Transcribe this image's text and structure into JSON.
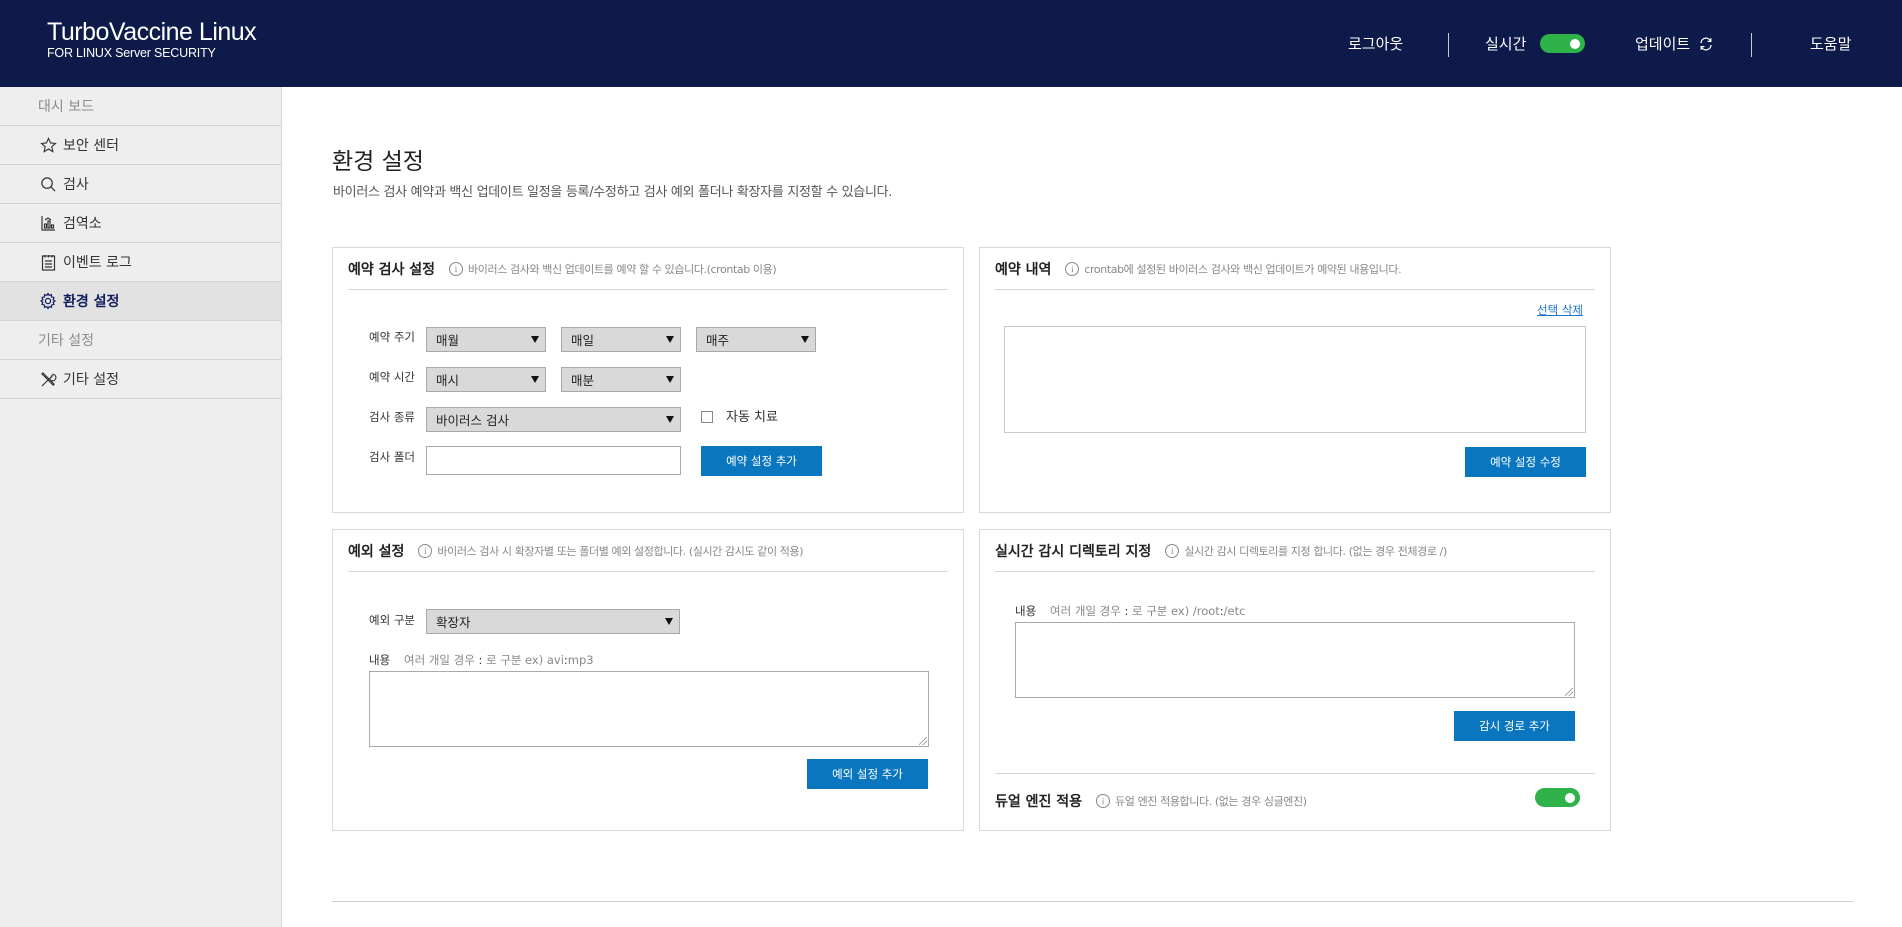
{
  "app": {
    "title": "TurboVaccine Linux",
    "subtitle": "FOR LINUX Server SECURITY"
  },
  "header": {
    "logout": "로그아웃",
    "realtime": "실시간",
    "realtime_on": true,
    "update": "업데이트",
    "help": "도움말"
  },
  "sidebar": {
    "section1": "대시 보드",
    "items": [
      {
        "label": "보안 센터",
        "icon": "star-icon"
      },
      {
        "label": "검사",
        "icon": "search-icon"
      },
      {
        "label": "검역소",
        "icon": "quarantine-icon"
      },
      {
        "label": "이벤트 로그",
        "icon": "log-icon"
      },
      {
        "label": "환경 설정",
        "icon": "gear-icon",
        "active": true
      }
    ],
    "section2": "기타 설정",
    "items2": [
      {
        "label": "기타 설정",
        "icon": "tools-icon"
      }
    ]
  },
  "page": {
    "title": "환경 설정",
    "description": "바이러스 검사 예약과 백신 업데이트 일정을 등록/수정하고 검사 예외 폴더나 확장자를 지정할 수 있습니다."
  },
  "schedule": {
    "title": "예약 검사 설정",
    "desc": "바이러스 검사와 백신 업데이트를 예약 할 수 있습니다.(crontab 이용)",
    "period_label": "예약 주기",
    "period_month": "매월",
    "period_day": "매일",
    "period_week": "매주",
    "time_label": "예약 시간",
    "time_hour": "매시",
    "time_minute": "매분",
    "type_label": "검사 종류",
    "type_value": "바이러스 검사",
    "auto_treat": "자동 치료",
    "folder_label": "검사 폴더",
    "folder_value": "",
    "add_button": "예약 설정 추가"
  },
  "history": {
    "title": "예약 내역",
    "desc": "crontab에 설정된 바이러스 검사와 백신 업데이트가 예약된 내용입니다.",
    "delete_link": "선택 삭제",
    "edit_button": "예약 설정 수정"
  },
  "exception": {
    "title": "예외 설정",
    "desc": "바이러스 검사 시 확장자별 또는 폴더별 예외 설정합니다. (실시간 감시도 같이 적용)",
    "type_label": "예외 구분",
    "type_value": "확장자",
    "content_label": "내용",
    "hint_a": "여러 개일 경우",
    "hint_colon": ":",
    "hint_b": "로 구분 ex) avi",
    "hint_c": "mp3",
    "add_button": "예외 설정 추가"
  },
  "realtime_dir": {
    "title": "실시간 감시 디렉토리 지정",
    "desc": "실시간 감시 디렉토리를 지정 합니다. (없는 경우 전체경로 /)",
    "content_label": "내용",
    "hint_a": "여러 개일 경우",
    "hint_colon": ":",
    "hint_b": "로 구분 ex) /root",
    "hint_c": "/etc",
    "add_button": "감시 경로 추가"
  },
  "dual_engine": {
    "title": "듀얼 엔진 적용",
    "desc": "듀얼 엔진 적용합니다. (없는 경우 싱글엔진)",
    "enabled": true
  },
  "colors": {
    "header_bg": "#0d1a4a",
    "accent": "#0a76c0",
    "toggle_on": "#2fb24a"
  }
}
